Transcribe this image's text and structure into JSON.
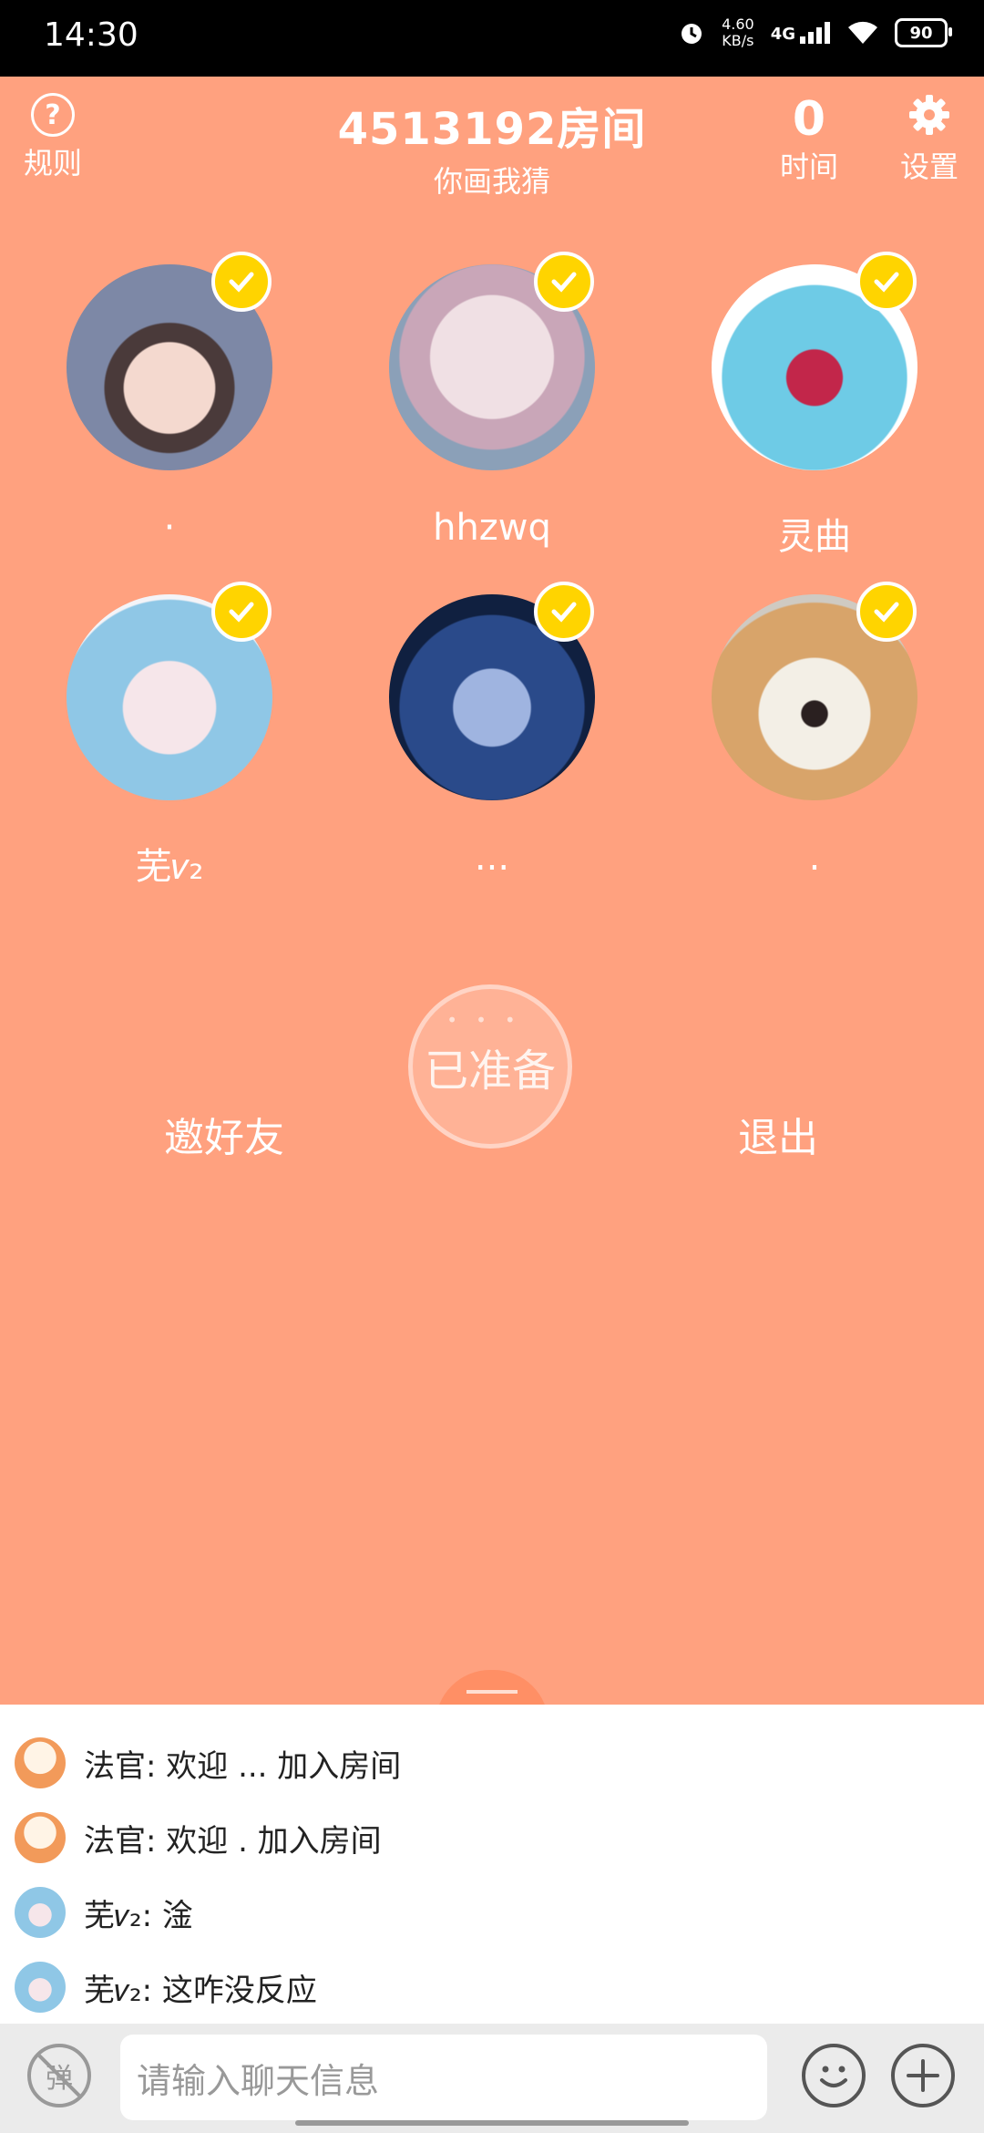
{
  "status": {
    "time": "14:30",
    "net_speed_top": "4.60",
    "net_speed_bottom": "KB/s",
    "network": "4G",
    "battery": "90"
  },
  "header": {
    "rules_label": "规则",
    "room_title": "4513192房间",
    "game_name": "你画我猜",
    "timer_value": "0",
    "timer_label": "时间",
    "settings_label": "设置"
  },
  "players": [
    {
      "name": "·",
      "ready": true
    },
    {
      "name": "hhzwq",
      "ready": true
    },
    {
      "name": "灵曲",
      "ready": true
    },
    {
      "name": "芜𝑣₂",
      "ready": true
    },
    {
      "name": "...",
      "ready": true
    },
    {
      "name": ".",
      "ready": true
    }
  ],
  "actions": {
    "ready_label": "已准备",
    "invite_label": "邀好友",
    "quit_label": "退出"
  },
  "chat": {
    "messages": [
      {
        "sender": "法官",
        "text": "法官: 欢迎 ... 加入房间"
      },
      {
        "sender": "法官",
        "text": "法官: 欢迎 . 加入房间"
      },
      {
        "sender": "芜",
        "text": "芜𝑣₂: 淦"
      },
      {
        "sender": "芜",
        "text": "芜𝑣₂: 这咋没反应"
      }
    ],
    "input_placeholder": "请输入聊天信息",
    "danmu_label": "弹"
  }
}
